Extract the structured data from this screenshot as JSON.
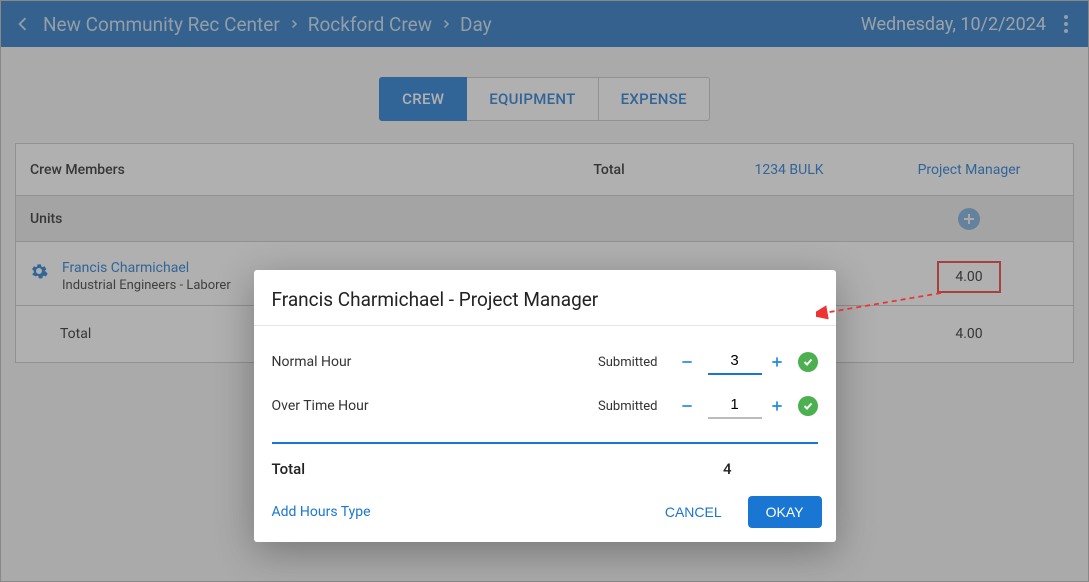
{
  "header": {
    "breadcrumb": [
      "New Community Rec Center",
      "Rockford Crew",
      "Day"
    ],
    "date": "Wednesday, 10/2/2024"
  },
  "tabs": {
    "items": [
      "CREW",
      "EQUIPMENT",
      "EXPENSE"
    ],
    "active": 0
  },
  "table": {
    "columns": {
      "members": "Crew Members",
      "total": "Total",
      "col3": "1234 BULK",
      "col4": "Project Manager"
    },
    "units_label": "Units",
    "rows": [
      {
        "name": "Francis Charmichael",
        "role": "Industrial Engineers - Laborer",
        "hours_col4": "4.00"
      }
    ],
    "totals": {
      "label": "Total",
      "col4": "4.00"
    }
  },
  "modal": {
    "title": "Francis Charmichael - Project Manager",
    "rows": [
      {
        "label": "Normal Hour",
        "status": "Submitted",
        "value": "3"
      },
      {
        "label": "Over Time Hour",
        "status": "Submitted",
        "value": "1"
      }
    ],
    "total_label": "Total",
    "total_value": "4",
    "add_hours": "Add Hours Type",
    "cancel": "CANCEL",
    "okay": "OKAY"
  }
}
